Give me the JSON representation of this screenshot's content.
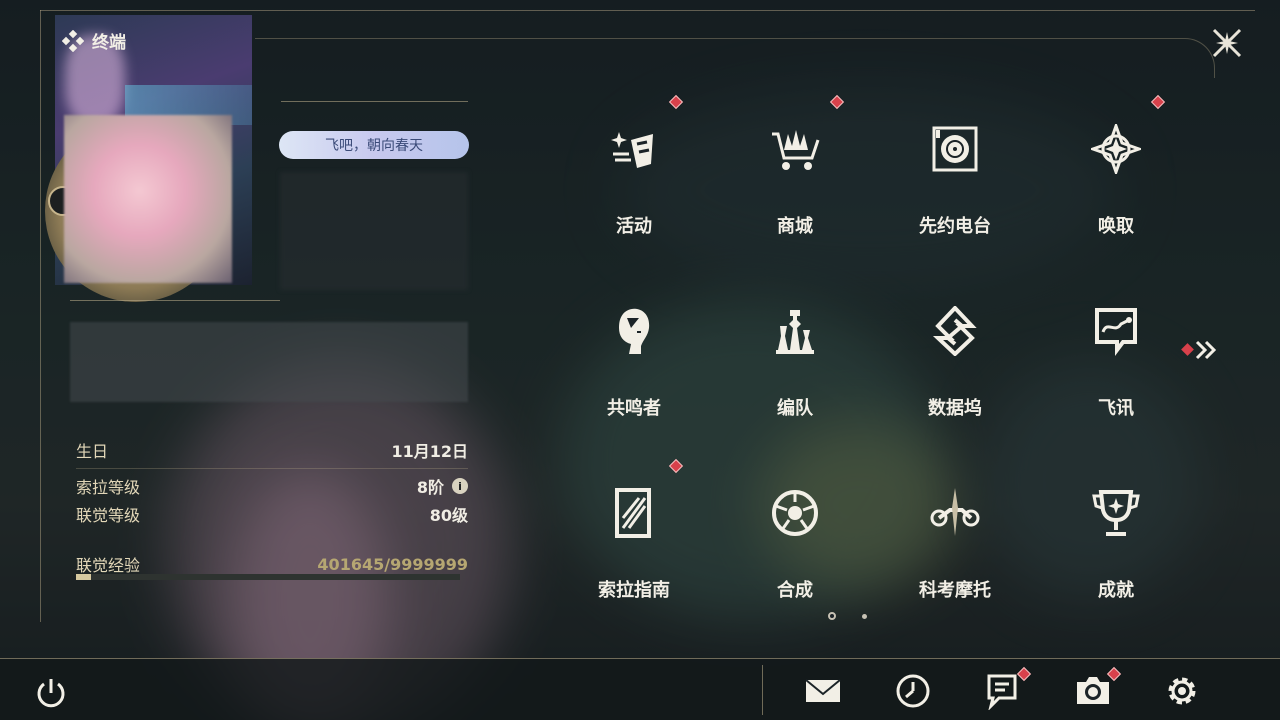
{
  "header": {
    "title": "终端",
    "close_icon": "close-x-icon"
  },
  "profile": {
    "motto": "飞吧，朝向春天",
    "birthday_label": "生日",
    "birthday_value": "11月12日",
    "sola_level_label": "索拉等级",
    "sola_level_value": "8阶",
    "union_level_label": "联觉等级",
    "union_level_value": "80级",
    "union_exp_label": "联觉经验",
    "union_exp_value": "401645/9999999",
    "union_exp_progress": 0.04
  },
  "menu": {
    "items": [
      {
        "label": "活动",
        "icon": "sparkle-flag-icon",
        "badge": true
      },
      {
        "label": "商城",
        "icon": "shopping-cart-icon",
        "badge": true
      },
      {
        "label": "先约电台",
        "icon": "radio-speaker-icon",
        "badge": false
      },
      {
        "label": "唤取",
        "icon": "convene-star-icon",
        "badge": true
      },
      {
        "label": "共鸣者",
        "icon": "resonator-head-icon",
        "badge": false
      },
      {
        "label": "编队",
        "icon": "chess-team-icon",
        "badge": false
      },
      {
        "label": "数据坞",
        "icon": "data-bank-icon",
        "badge": false
      },
      {
        "label": "飞讯",
        "icon": "chat-bubble-icon",
        "badge": false
      },
      {
        "label": "索拉指南",
        "icon": "guidebook-icon",
        "badge": true
      },
      {
        "label": "合成",
        "icon": "synthesis-orb-icon",
        "badge": false
      },
      {
        "label": "科考摩托",
        "icon": "motorbike-icon",
        "badge": false
      },
      {
        "label": "成就",
        "icon": "trophy-icon",
        "badge": false
      }
    ],
    "current_page": 1,
    "total_pages": 2
  },
  "bottom_bar": {
    "buttons": [
      {
        "name": "mail",
        "icon": "mail-icon",
        "badge": false
      },
      {
        "name": "clock",
        "icon": "clock-icon",
        "badge": false
      },
      {
        "name": "notice",
        "icon": "notice-board-icon",
        "badge": true
      },
      {
        "name": "camera",
        "icon": "camera-icon",
        "badge": true
      },
      {
        "name": "settings",
        "icon": "gear-icon",
        "badge": false
      }
    ]
  },
  "colors": {
    "accent_gold": "#c7b58c",
    "badge_red": "#d8414b",
    "text_light": "#f2efe6"
  }
}
